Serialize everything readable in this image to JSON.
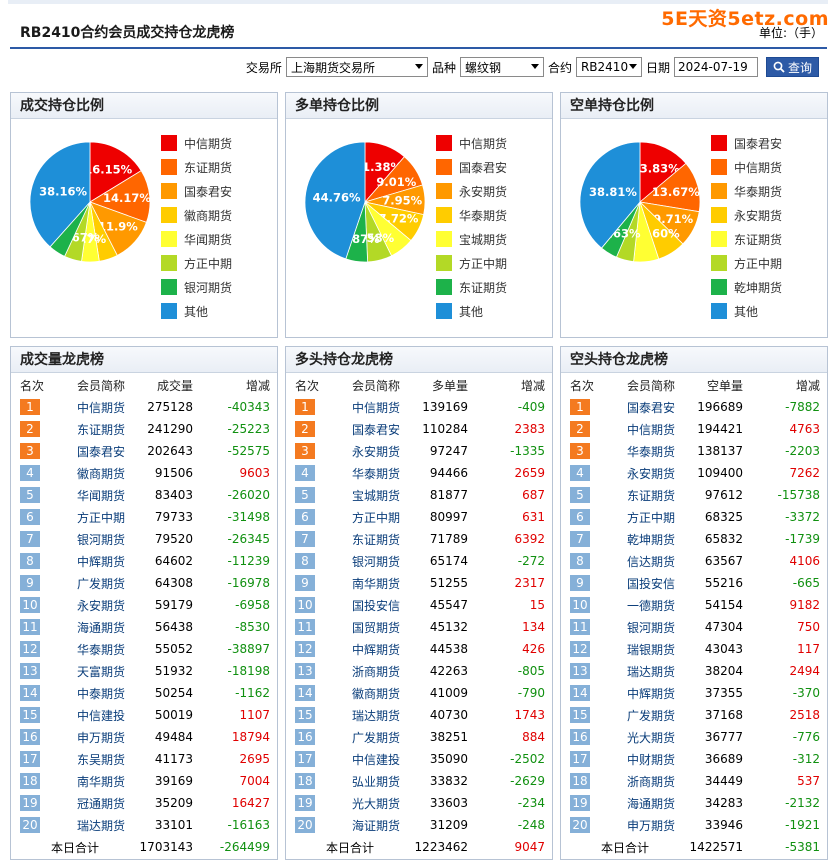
{
  "header": {
    "title": "RB2410合约会员成交持仓龙虎榜",
    "unit": "单位:（手）",
    "watermark": "5E天资5etz.com"
  },
  "filters": {
    "exchange_label": "交易所",
    "exchange_value": "上海期货交易所",
    "variety_label": "品种",
    "variety_value": "螺纹钢",
    "contract_label": "合约",
    "contract_value": "RB2410",
    "date_label": "日期",
    "date_value": "2024-07-19",
    "query_label": "查询"
  },
  "colors": [
    "#ee0000",
    "#ff6600",
    "#ff9900",
    "#ffcc00",
    "#ffff33",
    "#b3d926",
    "#1db24a",
    "#1e8fd8"
  ],
  "pies": [
    {
      "title": "成交持仓比例",
      "legend": [
        "中信期货",
        "东证期货",
        "国泰君安",
        "徽商期货",
        "华闻期货",
        "方正中期",
        "银河期货",
        "其他"
      ],
      "values": [
        16.15,
        14.17,
        11.9,
        5.0,
        4.7,
        4.67,
        4.6,
        38.16
      ],
      "labels": [
        "16.15%",
        "14.17%",
        "11.9%",
        "",
        "4.7%",
        "4.67%",
        "",
        "38.16%"
      ]
    },
    {
      "title": "多单持仓比例",
      "legend": [
        "中信期货",
        "国泰君安",
        "永安期货",
        "华泰期货",
        "宝城期货",
        "方正中期",
        "东证期货",
        "其他"
      ],
      "values": [
        11.38,
        9.01,
        7.95,
        7.72,
        6.6,
        6.58,
        5.87,
        44.76
      ],
      "labels": [
        "11.38%",
        "9.01%",
        "7.95%",
        "7.72%",
        "",
        "6.58%",
        "5.87%",
        "44.76%"
      ]
    },
    {
      "title": "空单持仓比例",
      "legend": [
        "国泰君安",
        "中信期货",
        "华泰期货",
        "永安期货",
        "东证期货",
        "方正中期",
        "乾坤期货",
        "其他"
      ],
      "values": [
        13.83,
        13.67,
        9.71,
        7.6,
        6.74,
        4.7,
        4.63,
        38.81
      ],
      "labels": [
        "13.83%",
        "13.67%",
        "9.71%",
        "7.60%",
        "",
        "",
        "4.63%",
        "38.81%"
      ]
    }
  ],
  "tables": [
    {
      "title": "成交量龙虎榜",
      "headers": [
        "名次",
        "会员简称",
        "成交量",
        "增减"
      ],
      "rows": [
        [
          "1",
          "中信期货",
          "275128",
          "-40343"
        ],
        [
          "2",
          "东证期货",
          "241290",
          "-25223"
        ],
        [
          "3",
          "国泰君安",
          "202643",
          "-52575"
        ],
        [
          "4",
          "徽商期货",
          "91506",
          "9603"
        ],
        [
          "5",
          "华闻期货",
          "83403",
          "-26020"
        ],
        [
          "6",
          "方正中期",
          "79733",
          "-31498"
        ],
        [
          "7",
          "银河期货",
          "79520",
          "-26345"
        ],
        [
          "8",
          "中辉期货",
          "64602",
          "-11239"
        ],
        [
          "9",
          "广发期货",
          "64308",
          "-16978"
        ],
        [
          "10",
          "永安期货",
          "59179",
          "-6958"
        ],
        [
          "11",
          "海通期货",
          "56438",
          "-8530"
        ],
        [
          "12",
          "华泰期货",
          "55052",
          "-38897"
        ],
        [
          "13",
          "天富期货",
          "51932",
          "-18198"
        ],
        [
          "14",
          "中泰期货",
          "50254",
          "-1162"
        ],
        [
          "15",
          "中信建投",
          "50019",
          "1107"
        ],
        [
          "16",
          "申万期货",
          "49484",
          "18794"
        ],
        [
          "17",
          "东吴期货",
          "41173",
          "2695"
        ],
        [
          "18",
          "南华期货",
          "39169",
          "7004"
        ],
        [
          "19",
          "冠通期货",
          "35209",
          "16427"
        ],
        [
          "20",
          "瑞达期货",
          "33101",
          "-16163"
        ]
      ],
      "total": [
        "本日合计",
        "1703143",
        "-264499"
      ]
    },
    {
      "title": "多头持仓龙虎榜",
      "headers": [
        "名次",
        "会员简称",
        "多单量",
        "增减"
      ],
      "rows": [
        [
          "1",
          "中信期货",
          "139169",
          "-409"
        ],
        [
          "2",
          "国泰君安",
          "110284",
          "2383"
        ],
        [
          "3",
          "永安期货",
          "97247",
          "-1335"
        ],
        [
          "4",
          "华泰期货",
          "94466",
          "2659"
        ],
        [
          "5",
          "宝城期货",
          "81877",
          "687"
        ],
        [
          "6",
          "方正中期",
          "80997",
          "631"
        ],
        [
          "7",
          "东证期货",
          "71789",
          "6392"
        ],
        [
          "8",
          "银河期货",
          "65174",
          "-272"
        ],
        [
          "9",
          "南华期货",
          "51255",
          "2317"
        ],
        [
          "10",
          "国投安信",
          "45547",
          "15"
        ],
        [
          "11",
          "国贸期货",
          "45132",
          "134"
        ],
        [
          "12",
          "中辉期货",
          "44538",
          "426"
        ],
        [
          "13",
          "浙商期货",
          "42263",
          "-805"
        ],
        [
          "14",
          "徽商期货",
          "41009",
          "-790"
        ],
        [
          "15",
          "瑞达期货",
          "40730",
          "1743"
        ],
        [
          "16",
          "广发期货",
          "38251",
          "884"
        ],
        [
          "17",
          "中信建投",
          "35090",
          "-2502"
        ],
        [
          "18",
          "弘业期货",
          "33832",
          "-2629"
        ],
        [
          "19",
          "光大期货",
          "33603",
          "-234"
        ],
        [
          "20",
          "海证期货",
          "31209",
          "-248"
        ]
      ],
      "total": [
        "本日合计",
        "1223462",
        "9047"
      ]
    },
    {
      "title": "空头持仓龙虎榜",
      "headers": [
        "名次",
        "会员简称",
        "空单量",
        "增减"
      ],
      "rows": [
        [
          "1",
          "国泰君安",
          "196689",
          "-7882"
        ],
        [
          "2",
          "中信期货",
          "194421",
          "4763"
        ],
        [
          "3",
          "华泰期货",
          "138137",
          "-2203"
        ],
        [
          "4",
          "永安期货",
          "109400",
          "7262"
        ],
        [
          "5",
          "东证期货",
          "97612",
          "-15738"
        ],
        [
          "6",
          "方正中期",
          "68325",
          "-3372"
        ],
        [
          "7",
          "乾坤期货",
          "65832",
          "-1739"
        ],
        [
          "8",
          "信达期货",
          "63567",
          "4106"
        ],
        [
          "9",
          "国投安信",
          "55216",
          "-665"
        ],
        [
          "10",
          "一德期货",
          "54154",
          "9182"
        ],
        [
          "11",
          "银河期货",
          "47304",
          "750"
        ],
        [
          "12",
          "瑞银期货",
          "43043",
          "117"
        ],
        [
          "13",
          "瑞达期货",
          "38204",
          "2494"
        ],
        [
          "14",
          "中辉期货",
          "37355",
          "-370"
        ],
        [
          "15",
          "广发期货",
          "37168",
          "2518"
        ],
        [
          "16",
          "光大期货",
          "36777",
          "-776"
        ],
        [
          "17",
          "中财期货",
          "36689",
          "-312"
        ],
        [
          "18",
          "浙商期货",
          "34449",
          "537"
        ],
        [
          "19",
          "海通期货",
          "34283",
          "-2132"
        ],
        [
          "20",
          "申万期货",
          "33946",
          "-1921"
        ]
      ],
      "total": [
        "本日合计",
        "1422571",
        "-5381"
      ]
    }
  ]
}
